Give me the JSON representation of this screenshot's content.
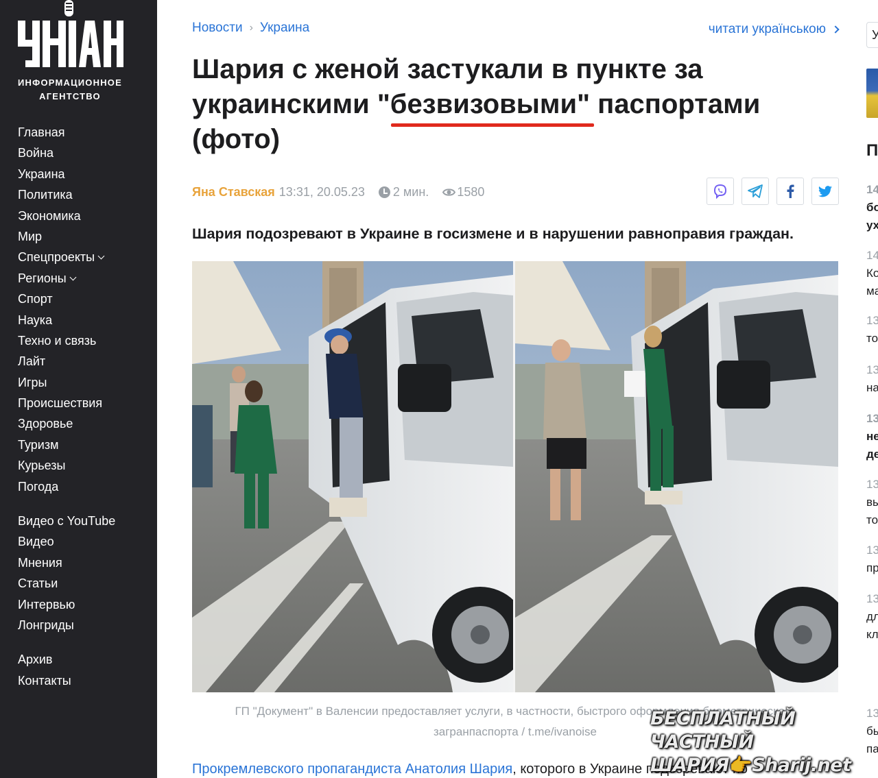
{
  "logo": {
    "wordmark": "УНІАН",
    "subtitle_line1": "ИНФОРМАЦИОННОЕ",
    "subtitle_line2": "АГЕНТСТВО"
  },
  "nav": {
    "main": [
      "Главная",
      "Война",
      "Украина",
      "Политика",
      "Экономика",
      "Мир",
      "Спецпроекты",
      "Регионы",
      "Спорт",
      "Наука",
      "Техно и связь",
      "Лайт",
      "Игры",
      "Происшествия",
      "Здоровье",
      "Туризм",
      "Курьезы",
      "Погода"
    ],
    "media": [
      "Видео с YouTube",
      "Видео",
      "Мнения",
      "Статьи",
      "Интервью",
      "Лонгриды"
    ],
    "misc": [
      "Архив",
      "Контакты"
    ]
  },
  "breadcrumb": {
    "item1": "Новости",
    "item2": "Украина"
  },
  "lang_switch": "читати українською",
  "article": {
    "title": "Шария с женой застукали в пункте за украинскими \"безвизовыми\" паспортами (фото)",
    "author": "Яна Ставская",
    "datetime": "13:31, 20.05.23",
    "read_time": "2 мин.",
    "views": "1580",
    "lead": "Шария подозревают в Украине в госизмене и в нарушении равноправия граждан.",
    "caption_line1": "ГП \"Документ\" в Валенсии предоставляет услуги, в частности, быстрого оформления биометрического",
    "caption_line2": "загранпаспорта / t.me/ivanoise",
    "body_link": "Прокремлевского пропагандиста Анатолия Шария",
    "body_rest": ", которого в Украине подозревают по"
  },
  "share": [
    "viber-icon",
    "telegram-icon",
    "facebook-icon",
    "twitter-icon"
  ],
  "accent_colors": {
    "link": "#2a74d6",
    "author": "#e8a33b",
    "underline": "#e02a1d",
    "sidebar": "#232327"
  },
  "watermark": {
    "line1": "БЕСПЛАТНЫЙ ЧАСТНЫЙ",
    "line2_a": "ШАРИЯ",
    "line2_b": "Sharij.net"
  },
  "right_column": {
    "search_char": "У",
    "heading_char": "П",
    "items": [
      {
        "time": "14",
        "line1": "бо",
        "line2": "ух",
        "bold": true
      },
      {
        "time": "14",
        "line1": "Ко",
        "line2": "ма",
        "bold": false
      },
      {
        "time": "13",
        "line1": "то",
        "line2": "",
        "bold": false
      },
      {
        "time": "13",
        "line1": "на",
        "line2": "",
        "bold": false
      },
      {
        "time": "13",
        "line1": "не",
        "line2": "де",
        "bold": true
      },
      {
        "time": "13",
        "line1": "вы",
        "line2": "то",
        "bold": false
      },
      {
        "time": "13",
        "line1": "пр",
        "line2": "",
        "bold": false
      },
      {
        "time": "13",
        "line1": "дл",
        "line2": "кл",
        "bold": false
      },
      {
        "time": "13",
        "line1": "бы",
        "line2": "па",
        "bold": false
      }
    ]
  }
}
